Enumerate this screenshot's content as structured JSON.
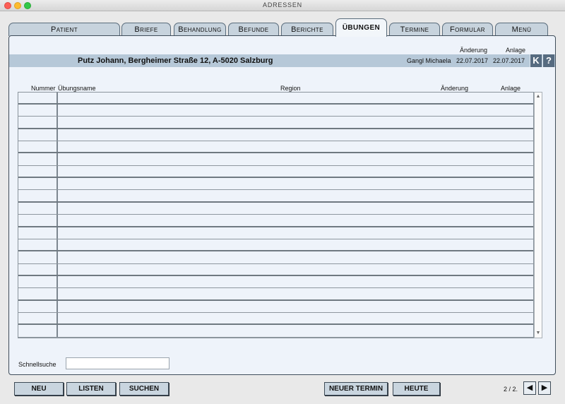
{
  "window": {
    "title": "ADRESSEN"
  },
  "tabs": [
    {
      "label": "Patient"
    },
    {
      "label": "Briefe"
    },
    {
      "label": "Behandlung"
    },
    {
      "label": "Befunde"
    },
    {
      "label": "Berichte"
    },
    {
      "label": "ÜBUNGEN"
    },
    {
      "label": "Termine"
    },
    {
      "label": "Formular"
    },
    {
      "label": "Menü"
    }
  ],
  "header": {
    "aenderung_label": "Änderung",
    "anlage_label": "Anlage"
  },
  "patient": {
    "name_address": "Putz Johann, Bergheimer Straße 12, A-5020 Salzburg",
    "user": "Gangl Michaela",
    "aenderung_date": "22.07.2017",
    "anlage_date": "22.07.2017",
    "k_label": "K",
    "help_label": "?"
  },
  "table": {
    "columns": [
      "Nummer",
      "Übungsname",
      "Region",
      "Änderung",
      "Anlage"
    ],
    "rows": []
  },
  "quicksearch": {
    "label": "Schnellsuche",
    "value": ""
  },
  "buttons": {
    "neu": "NEU",
    "listen": "LISTEN",
    "suchen": "SUCHEN",
    "neuer_termin": "NEUER TERMIN",
    "heute": "HEUTE"
  },
  "pagination": {
    "text": "2 / 2."
  },
  "icons": {
    "prev": "triangle-left-icon",
    "next": "triangle-right-icon",
    "scroll_up": "triangle-up-icon",
    "scroll_down": "triangle-down-icon"
  },
  "colors": {
    "tab": "#c7d3dd",
    "panel": "#eef3fa",
    "patient_bar": "#b6c8d8",
    "square_button": "#566b80"
  }
}
